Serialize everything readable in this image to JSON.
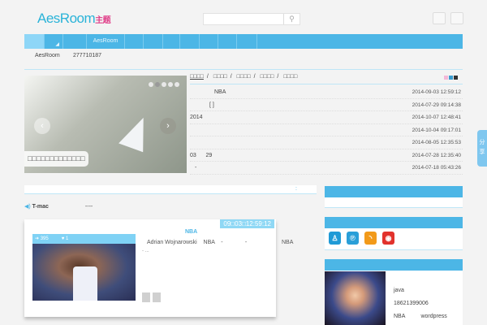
{
  "header": {
    "logo": "AesRoom",
    "logo_suffix": "主题",
    "search_placeholder": ""
  },
  "nav": {
    "items": [
      "",
      "",
      "",
      "AesRoom",
      "",
      "",
      "",
      "",
      "",
      "",
      ""
    ]
  },
  "info": {
    "name": "AesRoom",
    "qq": "277710187"
  },
  "slider": {
    "caption": "□□□□□□□□□□□□□",
    "prev": "‹",
    "next": "›"
  },
  "news": {
    "tabs": [
      "□□□□",
      "□□□□",
      "□□□□",
      "□□□□",
      "□□□□"
    ],
    "separator": "/",
    "rows": [
      {
        "title": "NBA",
        "date": "2014-09-03 12:59:12",
        "indent": true
      },
      {
        "title": "[ ]",
        "date": "2014-07-29 09:14:38",
        "indent": true
      },
      {
        "title": "2014",
        "date": "2014-10-07 12:48:41"
      },
      {
        "title": "",
        "date": "2014-10-04 09:17:01"
      },
      {
        "title": "",
        "date": "2014-08-05 12:35:53"
      },
      {
        "title": "03      29",
        "date": "2014-07-28 12:35:40"
      },
      {
        "title": "-",
        "date": "2014-07-18 05:43:26"
      }
    ],
    "colors": [
      "#f4b8d8",
      "#3a9ccf",
      "#333333"
    ]
  },
  "section": {
    "colon": ":"
  },
  "marquee": {
    "author": "T-mac",
    "text": "----"
  },
  "post": {
    "stamp": "09□03□12:59:12",
    "title": "NBA",
    "views": "395",
    "likes": "1",
    "excerpt": "Adrian Wojnarowski    NBA    -              -                      NBA",
    "excerpt2": "-   ..."
  },
  "sidebar": {
    "social": [
      "qq",
      "pinterest",
      "rss",
      "weibo"
    ],
    "profile": [
      "java",
      "18621399006",
      "NBA          wordpress"
    ]
  },
  "share": {
    "label": "分享"
  }
}
